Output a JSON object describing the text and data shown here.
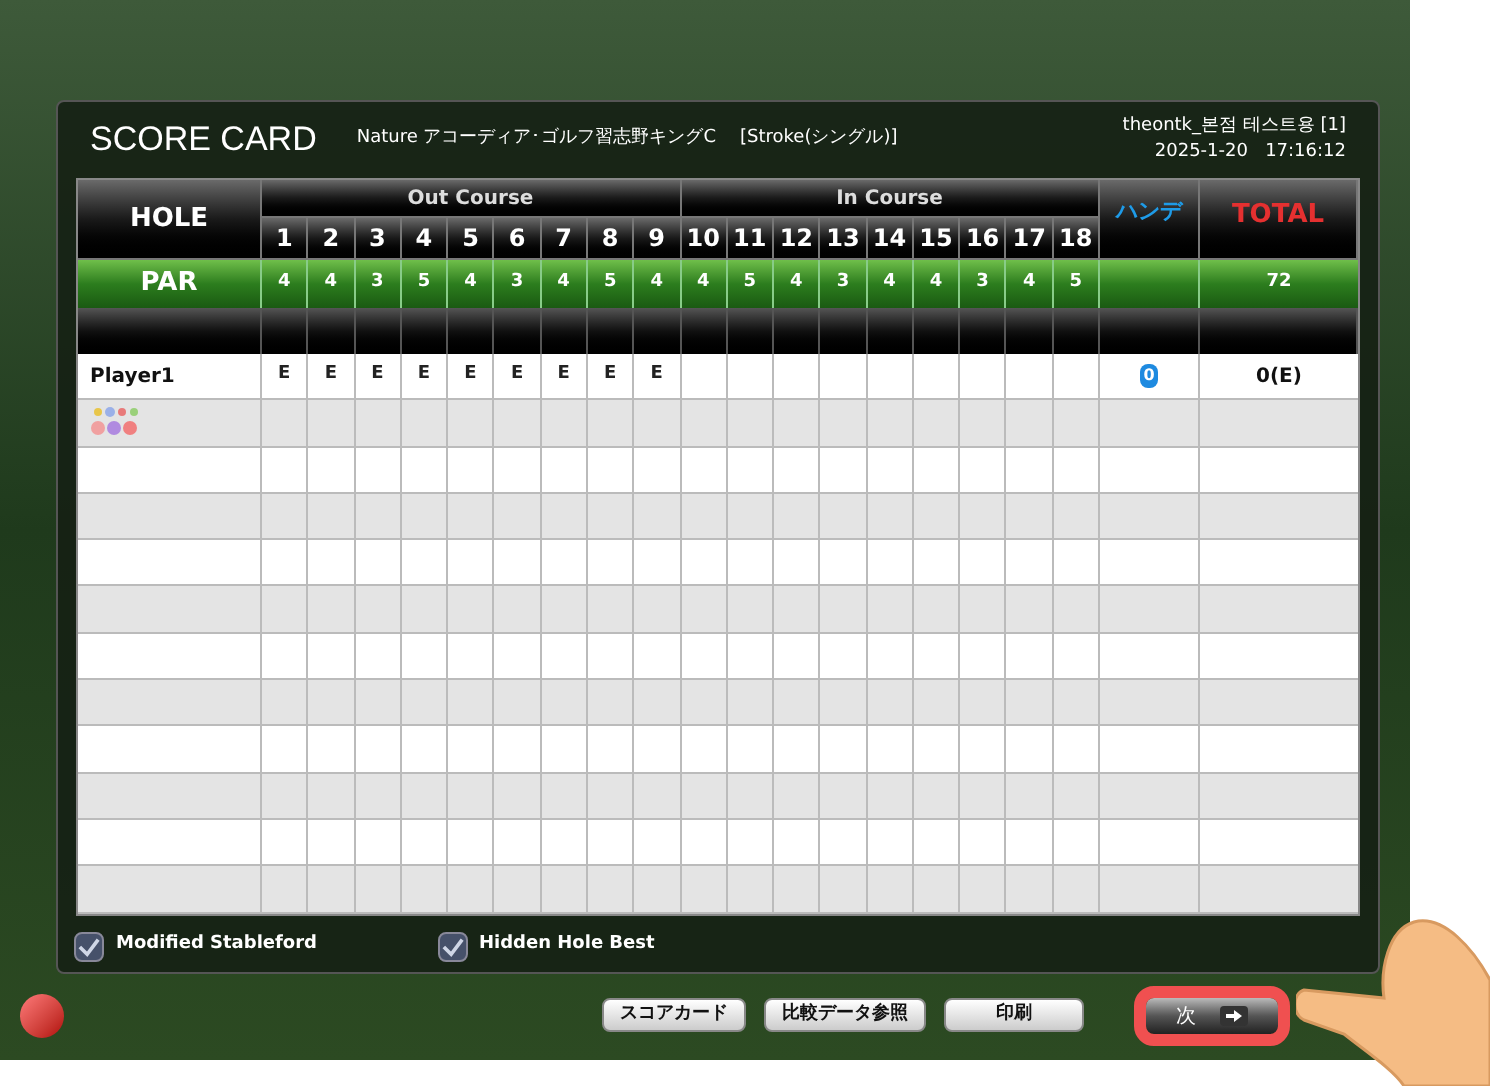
{
  "header": {
    "title": "SCORE CARD",
    "course": "Nature アコーディア･ゴルフ習志野キングC",
    "mode": "[Stroke(シングル)]",
    "user": "theontk_본점 테스트용 [1]",
    "datetime": "2025-1-20   17:16:12"
  },
  "table": {
    "hole_label": "HOLE",
    "out_label": "Out Course",
    "in_label": "In Course",
    "handicap_label": "ハンデ",
    "total_label": "TOTAL",
    "par_label": "PAR",
    "holes": [
      "1",
      "2",
      "3",
      "4",
      "5",
      "6",
      "7",
      "8",
      "9",
      "10",
      "11",
      "12",
      "13",
      "14",
      "15",
      "16",
      "17",
      "18"
    ],
    "par": [
      "4",
      "4",
      "3",
      "5",
      "4",
      "3",
      "4",
      "5",
      "4",
      "4",
      "5",
      "4",
      "3",
      "4",
      "4",
      "3",
      "4",
      "5"
    ],
    "par_total": "72",
    "players": [
      {
        "name": "Player1",
        "scores": [
          "E",
          "E",
          "E",
          "E",
          "E",
          "E",
          "E",
          "E",
          "E"
        ],
        "handicap": "0",
        "total": "0(E)"
      }
    ]
  },
  "options": [
    {
      "label": "Modified Stableford",
      "checked": true
    },
    {
      "label": "Hidden Hole Best",
      "checked": true
    }
  ],
  "buttons": [
    {
      "label": "スコアカード",
      "highlighted": false
    },
    {
      "label": "比較データ参照",
      "highlighted": false
    },
    {
      "label": "印刷",
      "highlighted": false
    },
    {
      "label": "次",
      "highlighted": true
    }
  ]
}
